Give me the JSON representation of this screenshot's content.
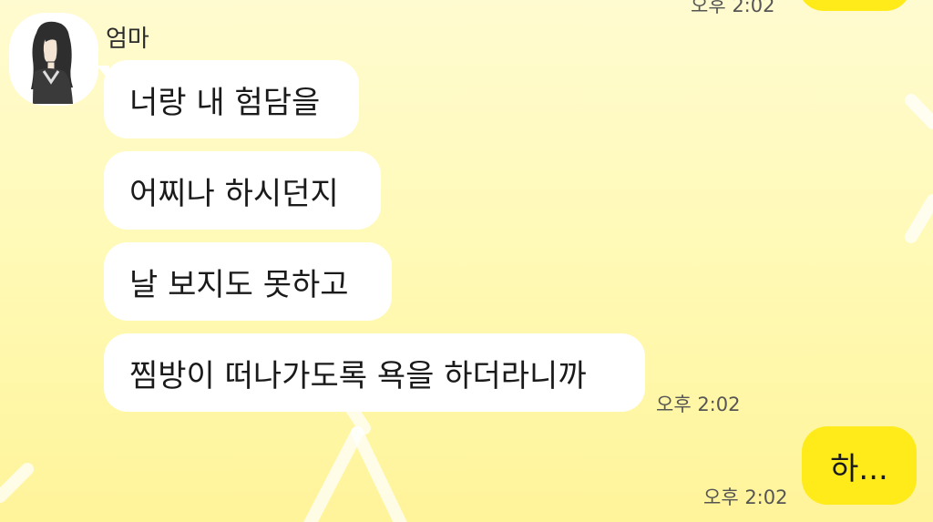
{
  "chat": {
    "previous": {
      "time": "오후 2:02"
    },
    "incoming": {
      "sender": "엄마",
      "messages": [
        "너랑 내 험담을",
        "어찌나 하시던지",
        "날 보지도 못하고",
        "찜방이 떠나가도록 욕을 하더라니까"
      ],
      "time": "오후 2:02"
    },
    "outgoing": {
      "message": "하...",
      "time": "오후 2:02"
    }
  },
  "colors": {
    "background": "#fff9c0",
    "my_bubble": "#ffeb1a",
    "their_bubble": "#ffffff"
  }
}
